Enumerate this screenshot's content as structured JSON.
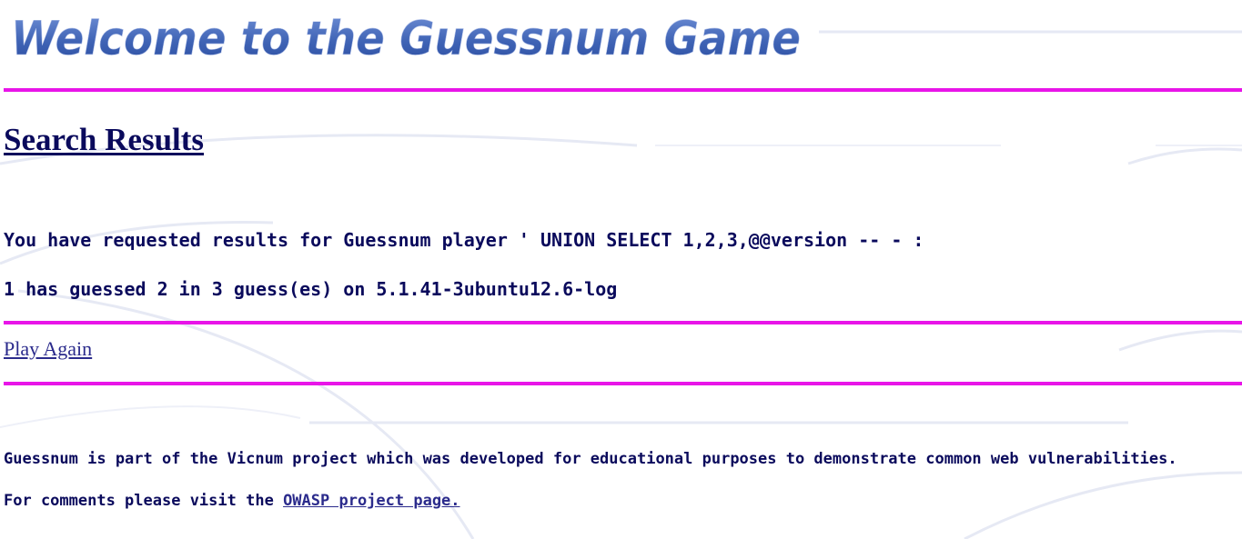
{
  "banner": {
    "title": "Welcome to the Guessnum Game"
  },
  "results": {
    "heading": "Search Results",
    "request_line": "You have requested results for Guessnum player ' UNION SELECT 1,2,3,@@version -- - :",
    "result_line": "1 has guessed 2 in 3 guess(es) on 5.1.41-3ubuntu12.6-log"
  },
  "nav": {
    "play_again_label": "Play Again"
  },
  "footer": {
    "about_text": "Guessnum is part of the Vicnum project which was developed for educational purposes to demonstrate common web vulnerabilities.",
    "comments_prefix": "For comments please visit the",
    "owasp_link_label": "OWASP project page."
  },
  "colors": {
    "rule": "#e815e8",
    "text": "#0a0a5c",
    "link": "#2b2b8c",
    "banner_text": "#3f63b5"
  }
}
